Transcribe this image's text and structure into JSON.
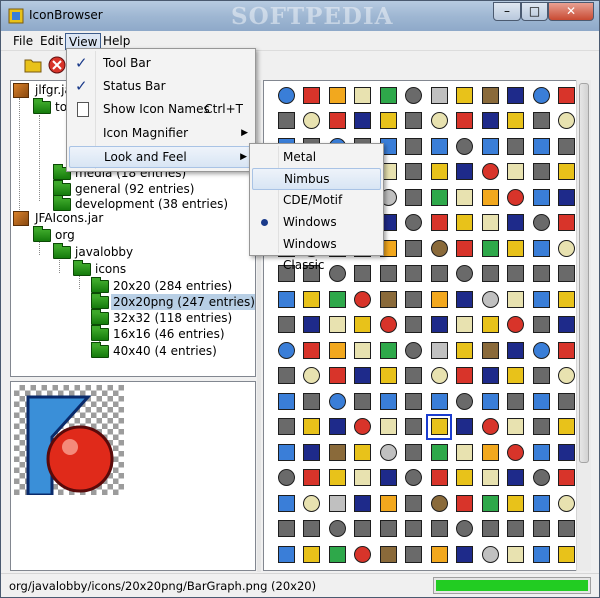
{
  "window": {
    "title": "IconBrowser",
    "watermark": "SOFTPEDIA",
    "controls": {
      "minimize": "–",
      "maximize": "□",
      "close": "✕"
    }
  },
  "menubar": {
    "items": [
      {
        "label": "File"
      },
      {
        "label": "Edit"
      },
      {
        "label": "View"
      },
      {
        "label": "Help"
      }
    ]
  },
  "toolbar": {
    "icons": [
      "folder-open-icon",
      "stop-icon"
    ]
  },
  "view_menu": {
    "items": [
      {
        "label": "Tool Bar",
        "checked": true
      },
      {
        "label": "Status Bar",
        "checked": true
      },
      {
        "label": "Show Icon Names",
        "accelerator": "Ctrl+T",
        "icon": "document-icon"
      },
      {
        "label": "Icon Magnifier",
        "submenu": true
      },
      {
        "label": "Look and Feel",
        "submenu": true
      }
    ]
  },
  "look_and_feel_menu": {
    "items": [
      {
        "label": "Metal"
      },
      {
        "label": "Nimbus"
      },
      {
        "label": "CDE/Motif"
      },
      {
        "label": "Windows",
        "selected": true
      },
      {
        "label": "Windows Classic"
      }
    ]
  },
  "tree": {
    "nodes": [
      {
        "label": "jlfgr.jar",
        "type": "jar",
        "depth": 0
      },
      {
        "label": "to",
        "type": "folder",
        "depth": 1
      },
      {
        "label": "media (18 entries)",
        "type": "folder",
        "depth": 2
      },
      {
        "label": "general (92 entries)",
        "type": "folder",
        "depth": 2
      },
      {
        "label": "development (38 entries)",
        "type": "folder",
        "depth": 2
      },
      {
        "label": "JFAIcons.jar",
        "type": "jar",
        "depth": 0
      },
      {
        "label": "org",
        "type": "folder",
        "depth": 1
      },
      {
        "label": "javalobby",
        "type": "folder",
        "depth": 2
      },
      {
        "label": "icons",
        "type": "folder",
        "depth": 3
      },
      {
        "label": "20x20 (284 entries)",
        "type": "folder",
        "depth": 4
      },
      {
        "label": "20x20png (247 entries)",
        "type": "folder",
        "depth": 4,
        "selected": true
      },
      {
        "label": "32x32 (118 entries)",
        "type": "folder",
        "depth": 4
      },
      {
        "label": "16x16 (46 entries)",
        "type": "folder",
        "depth": 4
      },
      {
        "label": "40x40 (4 entries)",
        "type": "folder",
        "depth": 4
      }
    ]
  },
  "preview": {
    "icon": "bar-graph-icon-magnified"
  },
  "icon_grid": {
    "columns": 12,
    "rows": 20,
    "selected_row": 13,
    "selected_col": 6,
    "palette": [
      "#3a7ed8",
      "#e8c21a",
      "#2ea84a",
      "#d8342a",
      "#8a6a3a",
      "#6a6a6a",
      "#f2a81e",
      "#1e2a8a",
      "#c0c0c0",
      "#e8e2b0"
    ]
  },
  "status": {
    "path": "org/javalobby/icons/20x20png/BarGraph.png (20x20)",
    "progress": 1.0,
    "progress_color": "#22cc22"
  }
}
